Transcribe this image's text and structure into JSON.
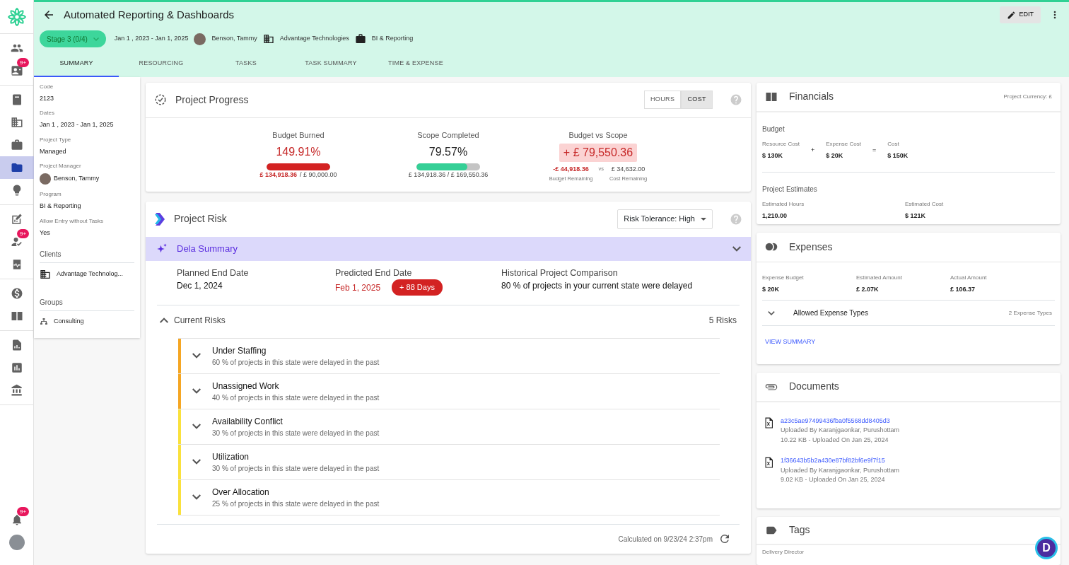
{
  "rail": {
    "groups": [
      [
        {
          "selected": false
        },
        {
          "selected": false,
          "badge": "9+"
        }
      ],
      [
        {
          "selected": false
        },
        {
          "selected": false
        },
        {
          "selected": false
        },
        {
          "selected": true
        },
        {
          "selected": false
        }
      ],
      [
        {
          "selected": false
        },
        {
          "selected": false,
          "badge": "9+"
        },
        {
          "selected": false
        }
      ],
      [
        {
          "selected": false
        },
        {
          "selected": false
        }
      ],
      [
        {
          "selected": false
        },
        {
          "selected": false
        },
        {
          "selected": false
        }
      ]
    ],
    "bottom": [
      {
        "kind": "bell",
        "badge": "9+"
      },
      {
        "kind": "avatar"
      }
    ]
  },
  "header": {
    "title": "Automated Reporting & Dashboards",
    "stage": "Stage 3 (0/4)",
    "dates": "Jan 1 , 2023 - Jan 1, 2025",
    "manager": "Benson, Tammy",
    "client": "Advantage Technologies",
    "program": "BI & Reporting",
    "edit": "EDIT"
  },
  "tabs": [
    {
      "label": "SUMMARY",
      "selected": true
    },
    {
      "label": "RESOURCING",
      "selected": false
    },
    {
      "label": "TASKS",
      "selected": false
    },
    {
      "label": "TASK SUMMARY",
      "selected": false
    },
    {
      "label": "TIME & EXPENSE",
      "selected": false
    }
  ],
  "details": {
    "fields": [
      {
        "label": "Code",
        "value": "2123",
        "kind": "text"
      },
      {
        "label": "Dates",
        "value": "Jan 1 , 2023 - Jan 1, 2025",
        "kind": "text"
      },
      {
        "label": "Project Type",
        "value": "Managed",
        "kind": "text"
      },
      {
        "label": "Project Manager",
        "value": "Benson, Tammy",
        "kind": "person"
      },
      {
        "label": "Program",
        "value": "BI & Reporting",
        "kind": "text"
      },
      {
        "label": "Allow Entry without Tasks",
        "value": "Yes",
        "kind": "text"
      }
    ],
    "sections": [
      {
        "title": "Clients",
        "items": [
          {
            "kind": "client",
            "label": "Advantage Technolog..."
          }
        ]
      },
      {
        "title": "Groups",
        "items": [
          {
            "kind": "group",
            "label": "Consulting"
          }
        ]
      }
    ]
  },
  "progress": {
    "title": "Project Progress",
    "toggle": [
      {
        "label": "HOURS",
        "selected": false
      },
      {
        "label": "COST",
        "selected": true
      }
    ],
    "metrics": [
      {
        "kind": "bar",
        "label": "Budget Burned",
        "value": "149.91%",
        "alert": true,
        "level": 1,
        "sub": [
          {
            "text": "£ 134,918.36",
            "alert": true
          },
          {
            "text": "/ £ 90,000.00",
            "alert": false
          }
        ]
      },
      {
        "kind": "bar",
        "label": "Scope Completed",
        "value": "79.57%",
        "alert": false,
        "level": 0.8,
        "sub": [
          {
            "text": "£ 134,918.36 / £ 169,550.36",
            "alert": false
          }
        ]
      },
      {
        "kind": "compare",
        "label": "Budget vs Scope",
        "value": "+ £ 79,550.36",
        "alert": true,
        "left": {
          "value": "-£ 44,918.36",
          "label": "Budget Remaining"
        },
        "vs": "vs",
        "right": {
          "value": "£ 34,632.00",
          "label": "Cost Remaining"
        }
      }
    ]
  },
  "risk": {
    "title": "Project Risk",
    "tolerance": "Risk Tolerance: High",
    "summary": {
      "title": "Dela Summary",
      "expanded": true,
      "items": [
        {
          "label": "Planned End Date",
          "value": "Dec 1, 2024",
          "late": false
        },
        {
          "label": "Predicted End Date",
          "value": "Feb 1, 2025",
          "late": true,
          "badge": "+ 88 Days"
        },
        {
          "label": "Historical Project Comparison",
          "value": "80 % of projects in your current state were delayed",
          "late": false
        }
      ]
    },
    "current": {
      "title": "Current Risks",
      "count": "5 Risks",
      "expanded": true,
      "items": [
        {
          "title": "Under Staffing",
          "detail": "60 % of projects in this state were delayed in the past",
          "color": "#f5a623"
        },
        {
          "title": "Unassigned Work",
          "detail": "40 % of projects in this state were delayed in the past",
          "color": "#f5a623"
        },
        {
          "title": "Availability Conflict",
          "detail": "30 % of projects in this state were delayed in the past",
          "color": "#fae13c"
        },
        {
          "title": "Utilization",
          "detail": "30 % of projects in this state were delayed in the past",
          "color": "#fae13c"
        },
        {
          "title": "Over Allocation",
          "detail": "25 % of projects in this state were delayed in the past",
          "color": "#fae13c"
        }
      ]
    },
    "calculated": "Calculated on 9/23/24 2:37pm"
  },
  "financials": {
    "title": "Financials",
    "currency": "Project Currency: £",
    "budget": {
      "title": "Budget",
      "items": [
        {
          "label": "Resource Cost",
          "value": "$ 130K"
        },
        {
          "label": "Expense Cost",
          "value": "$ 20K"
        },
        {
          "label": "Cost",
          "value": "$ 150K"
        }
      ],
      "operators": [
        "+",
        "="
      ]
    },
    "estimates": {
      "title": "Project Estimates",
      "items": [
        {
          "label": "Estimated Hours",
          "value": "1,210.00"
        },
        {
          "label": "Estimated Cost",
          "value": "$ 121K"
        }
      ]
    }
  },
  "expenses": {
    "title": "Expenses",
    "items": [
      {
        "label": "Expense Budget",
        "value": "$ 20K"
      },
      {
        "label": "Estimated Amount",
        "value": "£ 2.07K"
      },
      {
        "label": "Actual Amount",
        "value": "£ 106.37"
      }
    ],
    "types": {
      "label": "Allowed Expense Types",
      "count": "2 Expense Types",
      "expanded": false
    },
    "link": "VIEW SUMMARY"
  },
  "documents": {
    "title": "Documents",
    "items": [
      {
        "name": "a23c5ae97499436fba0f5568dd8405d3",
        "uploader": "Uploaded By Karanjgaonkar, Purushottam",
        "meta": "10.22 KB - Uploaded On Jan 25, 2024"
      },
      {
        "name": "1f36643b5b2a430e87bf82bf6e9f7f15",
        "uploader": "Uploaded By Karanjgaonkar, Purushottam",
        "meta": "9.02 KB - Uploaded On Jan 25, 2024"
      }
    ]
  },
  "tags": {
    "title": "Tags",
    "items": [
      {
        "label": "Delivery Director"
      }
    ]
  },
  "chat": {
    "label": "D"
  }
}
